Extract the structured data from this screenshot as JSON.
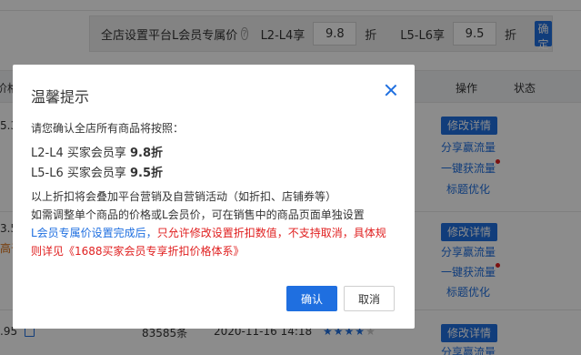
{
  "discount_bar": {
    "label": "全店设置平台L会员专属价",
    "help_icon": "question-circle-icon",
    "tier1_label": "L2-L4享",
    "tier1_value": "9.8",
    "tier1_unit": "折",
    "tier2_label": "L5-L6享",
    "tier2_value": "9.5",
    "tier2_unit": "折",
    "confirm_label": "确定"
  },
  "table": {
    "headers": {
      "price_partial": "价格",
      "operation": "操作",
      "status": "状态"
    },
    "rows": [
      {
        "price_partial": "5.30",
        "edit_label": "修改详情",
        "actions": [
          "分享赢流量",
          "一键获流量",
          "标题优化"
        ]
      },
      {
        "price_partial": "3.50",
        "note_partial": "高于",
        "edit_label": "修改详情",
        "actions": [
          "分享赢流量",
          "一键获流量",
          "标题优化"
        ]
      },
      {
        "price_partial": ".95",
        "count": "83585条",
        "time": "2020-11-16 14:18",
        "rating": 4,
        "edit_label": "修改详情",
        "actions": [
          "分享赢流量"
        ]
      }
    ]
  },
  "modal": {
    "title": "温馨提示",
    "close_icon": "close-icon",
    "intro": "请您确认全店所有商品将按照：",
    "rate1_text": "L2-L4 买家会员享 ",
    "rate1_value": "9.8折",
    "rate2_text": "L5-L6 买家会员享 ",
    "rate2_value": "9.5折",
    "line1": "以上折扣将会叠加平台营销及自营销活动（如折扣、店铺券等）",
    "line2": "如需调整单个商品的价格或L会员价，可在销售中的商品页面单独设置",
    "line3_blue": "L会员专属价设置完成后，",
    "line3_red": "只允许修改设置折扣数值，不支持取消，具体规",
    "line4_red": "则详见",
    "line4_link": "《1688买家会员专享折扣价格体系》",
    "ok_label": "确认",
    "cancel_label": "取消"
  },
  "colors": {
    "primary": "#1f6fe0",
    "danger": "#e02020",
    "mask": "rgba(0,0,0,0.45)"
  }
}
